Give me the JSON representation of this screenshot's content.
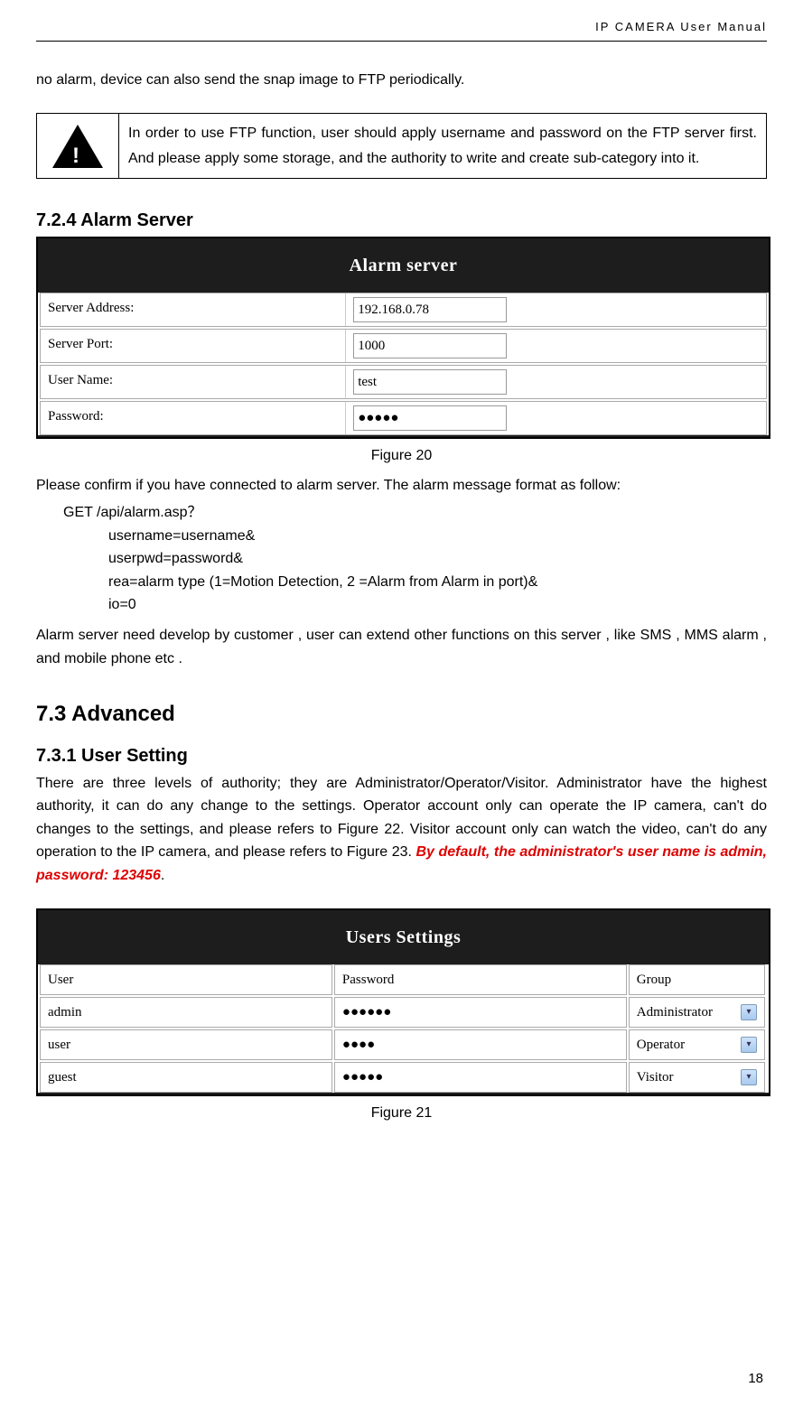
{
  "header": "IP CAMERA User Manual",
  "intro_continuation": "no alarm, device can also send the snap image to FTP periodically.",
  "warning_text": "In order to use FTP function, user should apply username and password on the FTP server first. And please apply some storage, and the authority to write and create sub-category into it.",
  "section_724": "7.2.4  Alarm Server",
  "alarm_panel": {
    "title": "Alarm server",
    "rows": [
      {
        "label": "Server Address:",
        "value": "192.168.0.78"
      },
      {
        "label": "Server Port:",
        "value": "1000"
      },
      {
        "label": "User Name:",
        "value": "test"
      },
      {
        "label": "Password:",
        "value": "●●●●●"
      }
    ]
  },
  "figure20": "Figure 20",
  "alarm_para": "Please confirm if you have connected to alarm server. The alarm message format as follow:",
  "code": {
    "l1": "GET /api/alarm.asp？",
    "l2": "username=username&",
    "l3": "userpwd=password&",
    "l4": "rea=alarm type (1=Motion Detection, 2 =Alarm from Alarm in port)&",
    "l5": "io=0"
  },
  "alarm_para2": "Alarm server need develop by customer , user can extend other functions on this server , like SMS , MMS alarm , and mobile phone etc .",
  "section_73": "7.3  Advanced",
  "section_731": "7.3.1  User Setting",
  "user_para_a": "There are three levels of authority; they are Administrator/Operator/Visitor. Administrator have the highest authority, it can do any change to the settings. Operator account only can operate the IP camera, can't do changes to the settings, and please refers to Figure 22. Visitor account only can watch the video, can't do any operation to the IP camera, and please refers to Figure 23. ",
  "user_para_red": "By default, the administrator's user name is admin, password: 123456",
  "users_panel": {
    "title": "Users Settings",
    "header": {
      "user": "User",
      "password": "Password",
      "group": "Group"
    },
    "rows": [
      {
        "user": "admin",
        "password": "●●●●●●",
        "group": "Administrator"
      },
      {
        "user": "user",
        "password": "●●●●",
        "group": "Operator"
      },
      {
        "user": "guest",
        "password": "●●●●●",
        "group": "Visitor"
      }
    ]
  },
  "figure21": "Figure 21",
  "page_number": "18"
}
